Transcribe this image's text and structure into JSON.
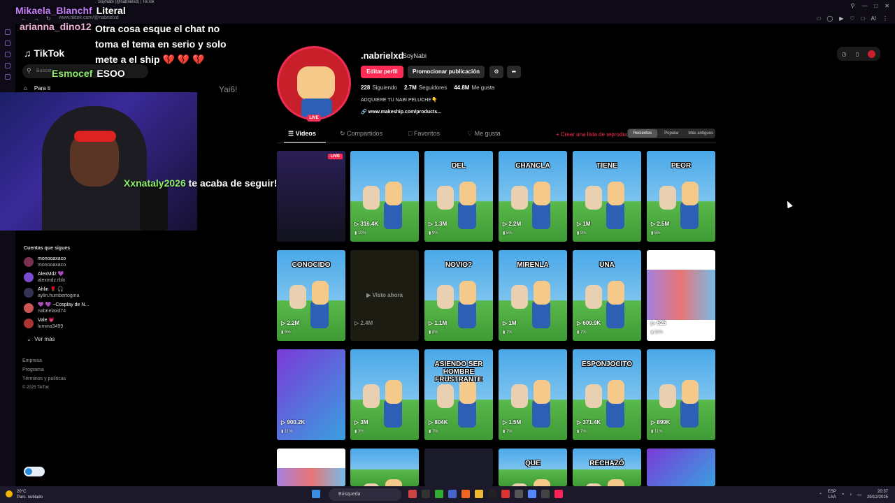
{
  "browser": {
    "tab_title": "SoyNabi (@nabrielxd) | TikTok",
    "tab_title_2": "SoyNabi (@nabrielxd)",
    "url": "www.tiktok.com/@nabrielxd",
    "ai_label": "AI"
  },
  "sidebar": {
    "logo": "TikTok",
    "search_placeholder": "Buscar",
    "for_you": "Para ti",
    "following_title": "Cuentas que sigues",
    "accounts": [
      {
        "name": "monooaxaco",
        "handle": "monooaxaco"
      },
      {
        "name": "AlexMdz 💜",
        "handle": "alexmdz.rblx"
      },
      {
        "name": "Ahlin 🌹 🎧",
        "handle": "aylin.humbertogma"
      },
      {
        "name": "💜 💜 ~Cosplay de N...",
        "handle": "nabrielaxd74"
      },
      {
        "name": "Vale 💗",
        "handle": "lumina3499"
      }
    ],
    "see_more": "Ver más",
    "footer": [
      "Empresa",
      "Programa",
      "Términos y políticas",
      "© 2025 TikTok"
    ]
  },
  "overlay": {
    "chat": [
      {
        "name": "Mikaela_Blanchf",
        "msg": "Literal",
        "color": "#c77dff"
      },
      {
        "name": "arianna_dino12",
        "msg": "Otra cosa esque el chat no toma el tema en serio y solo mete a el ship 💔 💔 💔",
        "color": "#f0b0d8"
      },
      {
        "name": "Esmocef",
        "msg": "ESOO",
        "color": "#8df06a"
      }
    ],
    "follow_alert_user": "Xxnataly2026",
    "follow_alert_text": "te acaba de seguir!",
    "yai_text": "Yai6!"
  },
  "profile": {
    "username": ".nabrielxd",
    "display_name": "SoyNabi",
    "live_label": "LIVE",
    "edit_button": "Editar perfil",
    "promote_button": "Promocionar publicación",
    "stats": [
      {
        "value": "228",
        "label": "Siguiendo"
      },
      {
        "value": "2.7M",
        "label": "Seguidores"
      },
      {
        "value": "44.8M",
        "label": "Me gusta"
      }
    ],
    "bio": "ADQUIERE TU NABI PELUCHE👇",
    "link": "www.makeship.com/products..."
  },
  "tabs": {
    "videos": "Videos",
    "reposts": "Compartidos",
    "favorites": "Favoritos",
    "liked": "Me gusta",
    "create_list": "+ Crear una lista de reproducción",
    "sort": [
      "Recientes",
      "Popular",
      "Más antiguos"
    ]
  },
  "videos": [
    {
      "caption": "",
      "views": "",
      "pct": "",
      "kind": "live",
      "live": "LIVE"
    },
    {
      "caption": "",
      "views": "316.4K",
      "pct": "10%",
      "kind": "normal"
    },
    {
      "caption": "DEL",
      "views": "1.3M",
      "pct": "9%",
      "kind": "normal"
    },
    {
      "caption": "CHANCLA",
      "views": "2.2M",
      "pct": "5%",
      "kind": "normal"
    },
    {
      "caption": "TIENE",
      "views": "1M",
      "pct": "9%",
      "kind": "normal"
    },
    {
      "caption": "PEOR",
      "views": "2.5M",
      "pct": "6%",
      "kind": "normal"
    },
    {
      "caption": "CONOCIDO",
      "views": "2.2M",
      "pct": "6%",
      "kind": "normal"
    },
    {
      "caption": "",
      "views": "2.4M",
      "pct": "",
      "kind": "dim",
      "watched": "Visto ahora"
    },
    {
      "caption": "NOVIO?",
      "views": "1.1M",
      "pct": "8%",
      "kind": "normal"
    },
    {
      "caption": "MIRENLA",
      "views": "1M",
      "pct": "7%",
      "kind": "normal"
    },
    {
      "caption": "UNA",
      "views": "609.9K",
      "pct": "7%",
      "kind": "normal"
    },
    {
      "caption": "",
      "views": "525",
      "pct": "31%",
      "kind": "white"
    },
    {
      "caption": "",
      "views": "900.2K",
      "pct": "11%",
      "kind": "art"
    },
    {
      "caption": "",
      "views": "3M",
      "pct": "3%",
      "kind": "normal"
    },
    {
      "caption": "ASIENDO SER HOMBRE FRUSTRANTE",
      "views": "804K",
      "pct": "7%",
      "kind": "normal"
    },
    {
      "caption": "",
      "views": "1.5M",
      "pct": "7%",
      "kind": "normal"
    },
    {
      "caption": "ESPONJOCITO",
      "views": "371.4K",
      "pct": "7%",
      "kind": "normal"
    },
    {
      "caption": "",
      "views": "899K",
      "pct": "11%",
      "kind": "normal"
    },
    {
      "caption": "",
      "views": "",
      "pct": "",
      "kind": "white"
    },
    {
      "caption": "",
      "views": "",
      "pct": "",
      "kind": "normal"
    },
    {
      "caption": "",
      "views": "",
      "pct": "",
      "kind": "dark"
    },
    {
      "caption": "QUE",
      "views": "",
      "pct": "",
      "kind": "normal"
    },
    {
      "caption": "RECHAZÓ",
      "views": "",
      "pct": "",
      "kind": "normal"
    },
    {
      "caption": "",
      "views": "",
      "pct": "",
      "kind": "art"
    }
  ],
  "taskbar": {
    "weather_temp": "20°C",
    "weather_desc": "Parc. nublado",
    "search": "Búsqueda",
    "lang": "ESP",
    "lang2": "LAA",
    "time": "20:37",
    "date": "29/12/2025"
  }
}
